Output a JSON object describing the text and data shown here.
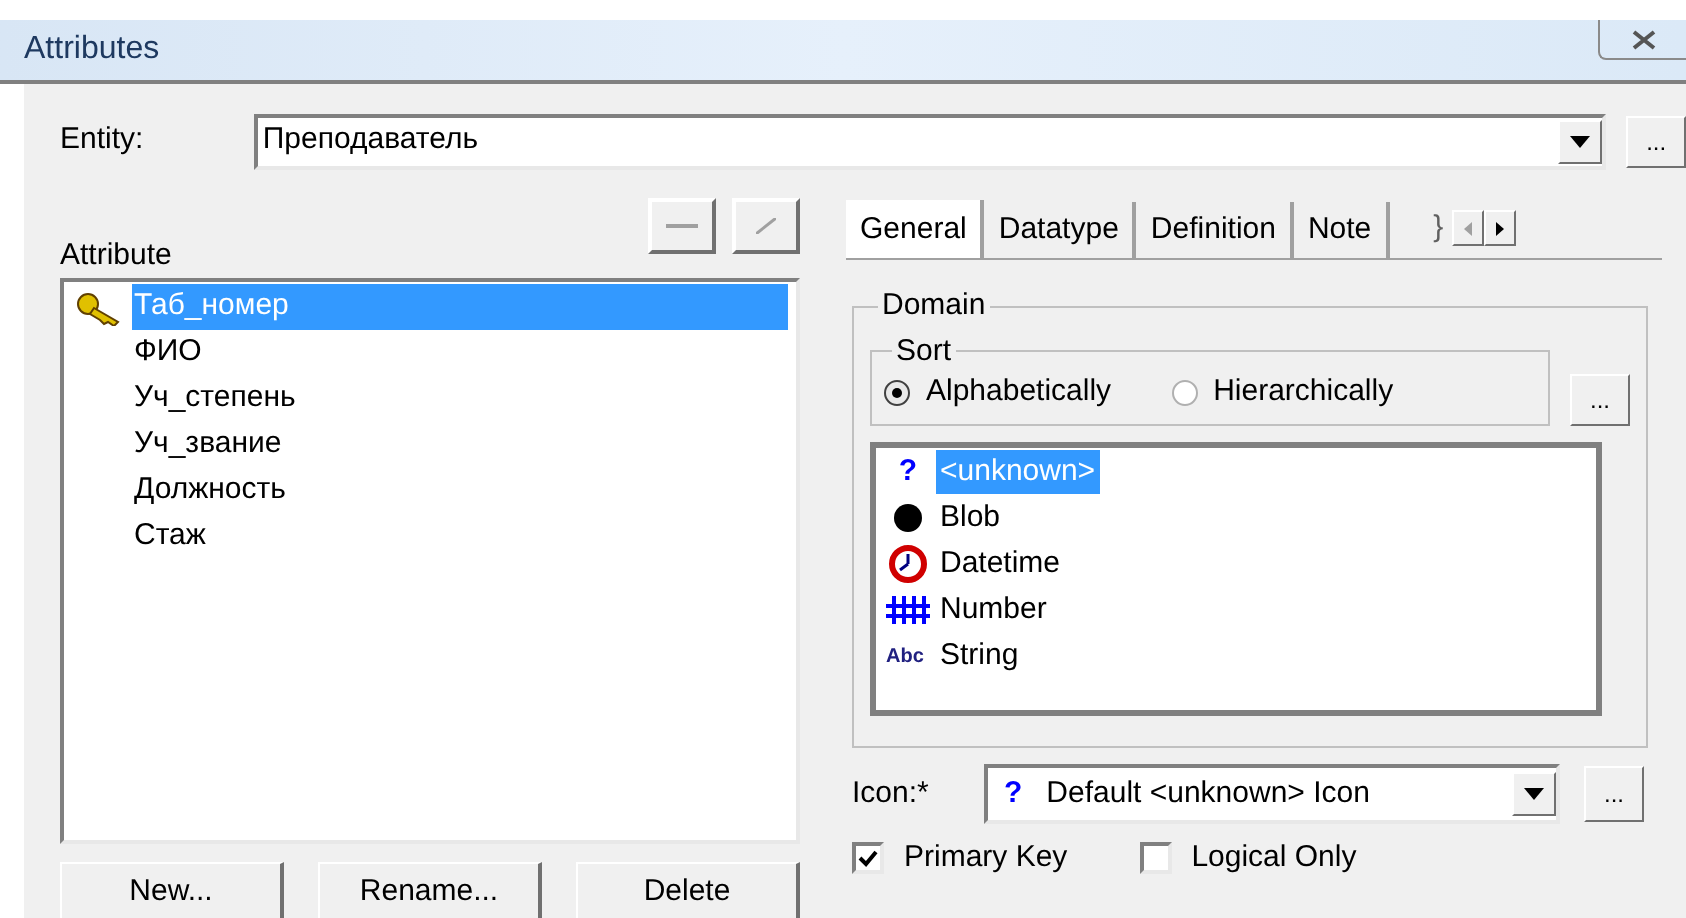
{
  "window": {
    "title": "Attributes"
  },
  "entity": {
    "label": "Entity:",
    "value": "Преподаватель",
    "browse": "..."
  },
  "attributes": {
    "label": "Attribute",
    "items": [
      {
        "text": "Таб_номер",
        "selected": true,
        "key": true
      },
      {
        "text": "ФИО",
        "selected": false,
        "key": false
      },
      {
        "text": "Уч_степень",
        "selected": false,
        "key": false
      },
      {
        "text": "Уч_звание",
        "selected": false,
        "key": false
      },
      {
        "text": "Должность",
        "selected": false,
        "key": false
      },
      {
        "text": "Стаж",
        "selected": false,
        "key": false
      }
    ],
    "buttons": [
      "New...",
      "Rename...",
      "Delete"
    ]
  },
  "tabs": [
    {
      "label": "General",
      "selected": true
    },
    {
      "label": "Datatype",
      "selected": false
    },
    {
      "label": "Definition",
      "selected": false
    },
    {
      "label": "Note",
      "selected": false
    }
  ],
  "clipped_tab": "}",
  "domain": {
    "label": "Domain",
    "sort": {
      "label": "Sort",
      "options": [
        {
          "label": "Alphabetically",
          "selected": true
        },
        {
          "label": "Hierarchically",
          "selected": false
        }
      ]
    },
    "browse": "...",
    "types": [
      {
        "label": "<unknown>",
        "kind": "unknown",
        "glyph": "?",
        "selected": true
      },
      {
        "label": "Blob",
        "kind": "blob",
        "selected": false
      },
      {
        "label": "Datetime",
        "kind": "datetime",
        "selected": false
      },
      {
        "label": "Number",
        "kind": "number",
        "selected": false
      },
      {
        "label": "String",
        "kind": "string",
        "glyph": "Abc",
        "selected": false
      }
    ]
  },
  "icon": {
    "label": "Icon:*",
    "glyph": "?",
    "value": "Default <unknown> Icon",
    "browse": "..."
  },
  "checkboxes": [
    {
      "label": "Primary Key",
      "checked": true
    },
    {
      "label": "Logical Only",
      "checked": false
    }
  ]
}
